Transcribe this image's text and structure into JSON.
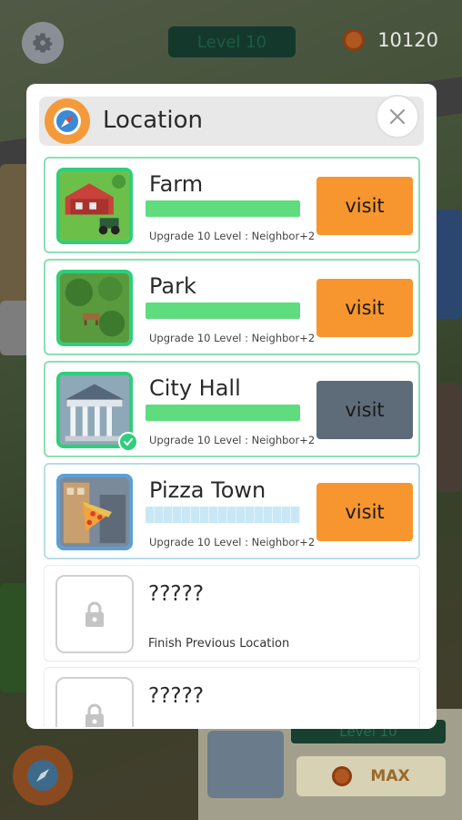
{
  "hud": {
    "level": "Level 10",
    "coins": "10120",
    "settings_icon": "gear-icon",
    "coin_icon": "coin-icon"
  },
  "bottom_panel": {
    "level": "Level 10",
    "max_label": "MAX"
  },
  "modal": {
    "title": "Location",
    "icon": "compass-icon",
    "close_icon": "close-icon"
  },
  "locations": [
    {
      "name": "Farm",
      "requirement": "Upgrade 10 Level : Neighbor+2",
      "visit_label": "visit",
      "status": "unlocked",
      "progress": 1.0
    },
    {
      "name": "Park",
      "requirement": "Upgrade 10 Level : Neighbor+2",
      "visit_label": "visit",
      "status": "unlocked",
      "progress": 1.0
    },
    {
      "name": "City Hall",
      "requirement": "Upgrade 10 Level : Neighbor+2",
      "visit_label": "visit",
      "status": "current",
      "progress": 1.0
    },
    {
      "name": "Pizza Town",
      "requirement": "Upgrade 10 Level : Neighbor+2",
      "visit_label": "visit",
      "status": "in-progress",
      "progress": 0.0
    },
    {
      "name": "?????",
      "requirement": "Finish Previous Location",
      "status": "locked"
    },
    {
      "name": "?????",
      "status": "locked"
    }
  ],
  "colors": {
    "visit_button": "#f7962e",
    "current_button": "#5e6b78",
    "progress_full": "#5fdc7e",
    "progress_empty": "#c8e8f6",
    "unlocked_border": "#8be0b4"
  }
}
